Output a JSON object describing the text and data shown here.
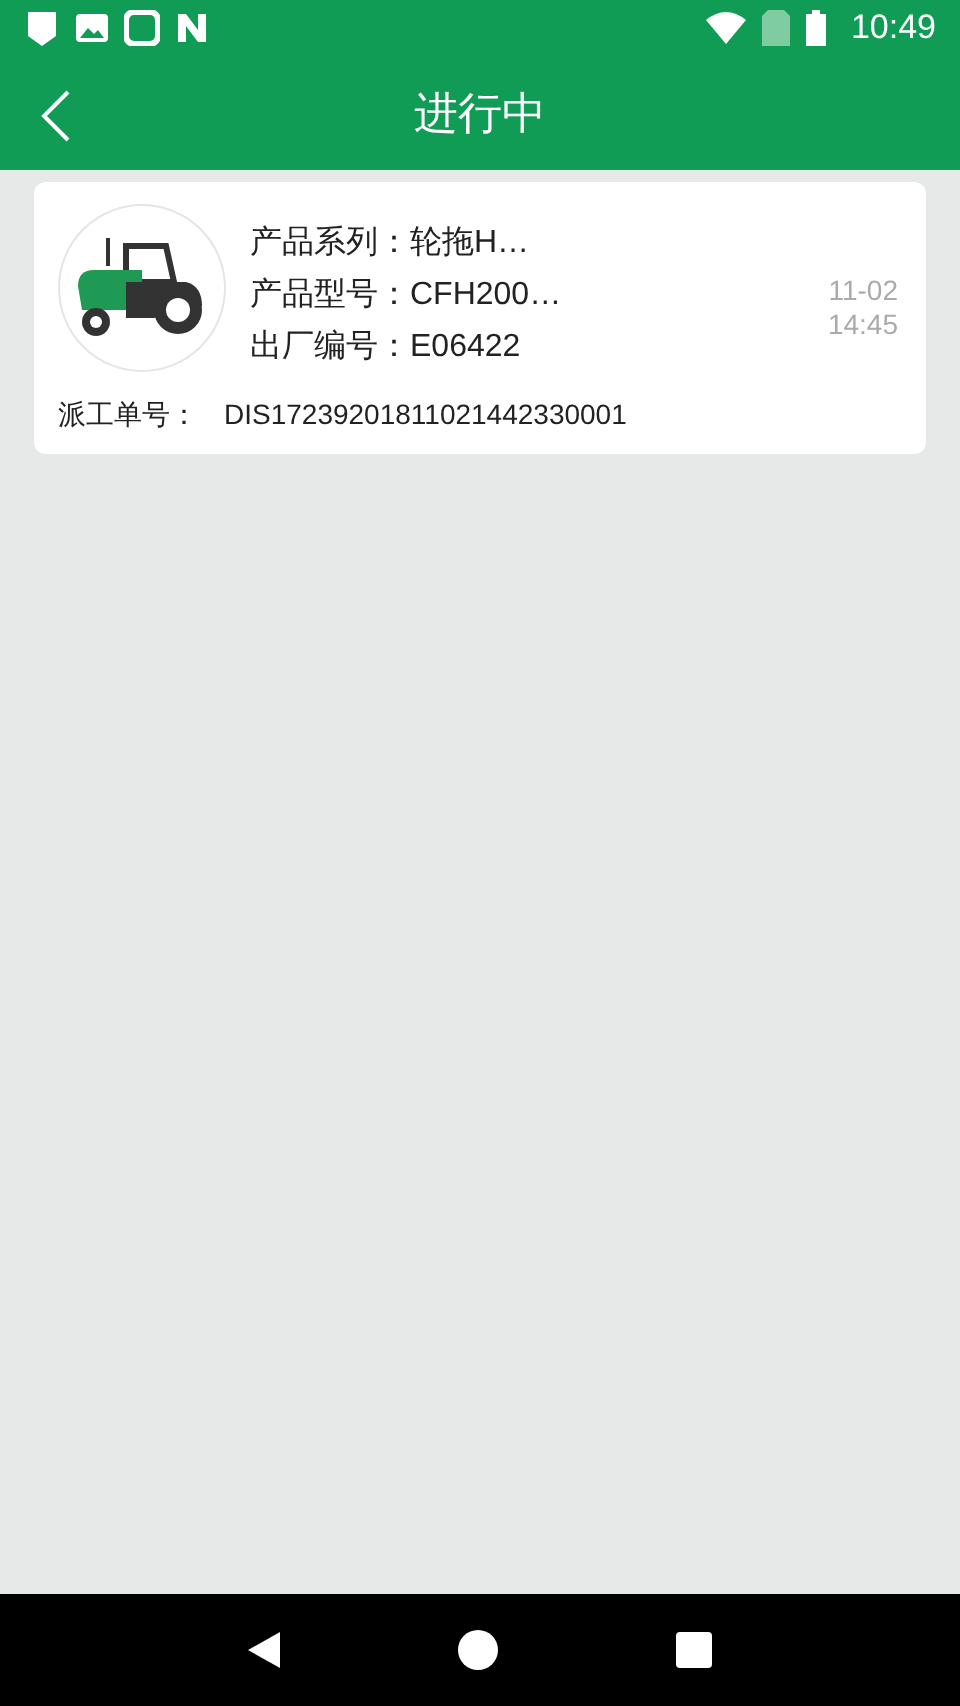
{
  "status_bar": {
    "time": "10:49"
  },
  "header": {
    "title": "进行中"
  },
  "orders": [
    {
      "fields": [
        {
          "label": "产品系列：",
          "value": "轮拖H…"
        },
        {
          "label": "产品型号：",
          "value": "CFH200…"
        },
        {
          "label": "出厂编号：",
          "value": "E06422"
        }
      ],
      "date": "11-02",
      "time": "14:45",
      "dispatch_label": "派工单号：",
      "dispatch_no": "DIS17239201811021442330001"
    }
  ]
}
